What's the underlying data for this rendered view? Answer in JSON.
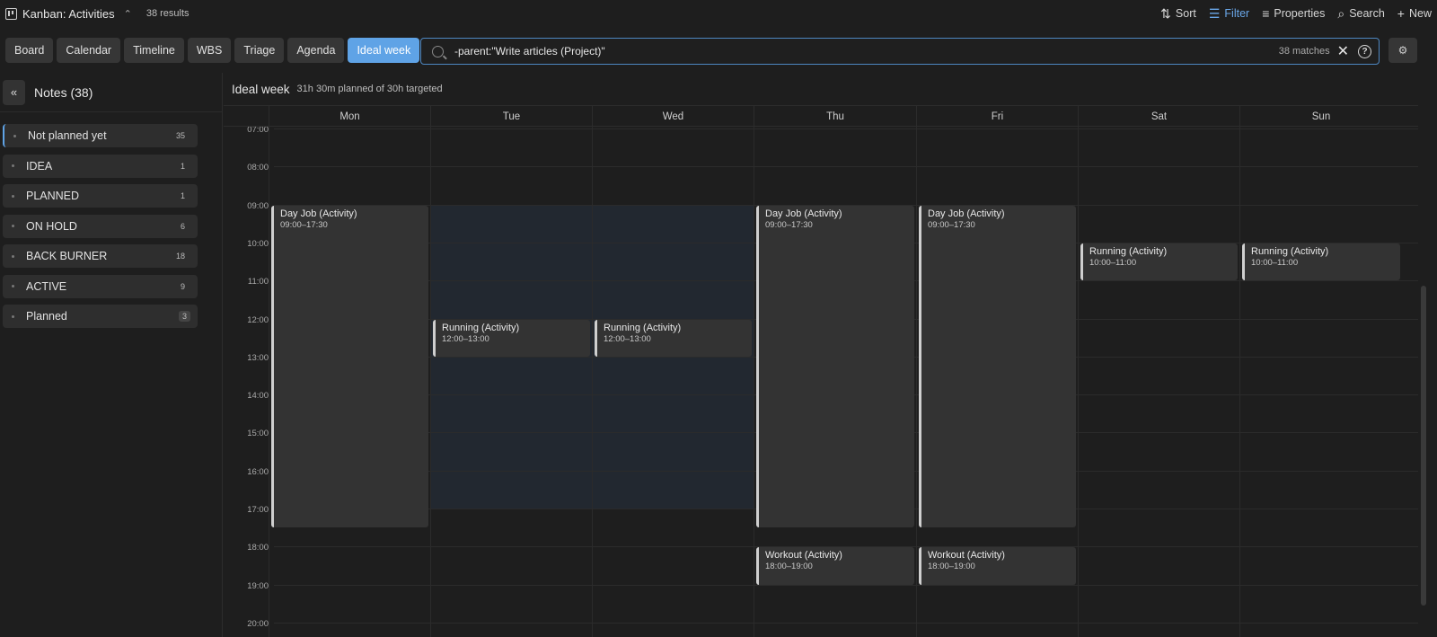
{
  "topbar": {
    "title": "Kanban: Activities",
    "results": "38 results",
    "actions": [
      {
        "name": "sort",
        "label": "Sort",
        "icon": "sort-icon"
      },
      {
        "name": "filter",
        "label": "Filter",
        "icon": "filter-icon",
        "active": true
      },
      {
        "name": "properties",
        "label": "Properties",
        "icon": "list-icon"
      },
      {
        "name": "search",
        "label": "Search",
        "icon": "search-icon"
      },
      {
        "name": "new",
        "label": "New",
        "icon": "plus-icon"
      }
    ]
  },
  "views": [
    "Board",
    "Calendar",
    "Timeline",
    "WBS",
    "Triage",
    "Agenda",
    "Ideal week"
  ],
  "active_view": "Ideal week",
  "search": {
    "query": "-parent:\"Write articles (Project)\"",
    "matches": "38 matches"
  },
  "sidebar": {
    "title": "Notes (38)",
    "groups": [
      {
        "label": "Not planned yet",
        "count": "35"
      },
      {
        "label": "IDEA",
        "count": "1"
      },
      {
        "label": "PLANNED",
        "count": "1"
      },
      {
        "label": "ON HOLD",
        "count": "6"
      },
      {
        "label": "BACK BURNER",
        "count": "18"
      },
      {
        "label": "ACTIVE",
        "count": "9"
      },
      {
        "label": "Planned",
        "count": "3"
      }
    ]
  },
  "calendar": {
    "title": "Ideal week",
    "summary": "31h 30m planned of 30h targeted",
    "days": [
      "Mon",
      "Tue",
      "Wed",
      "Thu",
      "Fri",
      "Sat",
      "Sun"
    ],
    "hours": [
      "07:00",
      "08:00",
      "09:00",
      "10:00",
      "11:00",
      "12:00",
      "13:00",
      "14:00",
      "15:00",
      "16:00",
      "17:00",
      "18:00",
      "19:00",
      "20:00"
    ],
    "events": [
      {
        "day": 0,
        "name": "Day Job (Activity)",
        "time": "09:00–17:30",
        "start": 9,
        "end": 17.5
      },
      {
        "day": 1,
        "name": "Running (Activity)",
        "time": "12:00–13:00",
        "start": 12,
        "end": 13
      },
      {
        "day": 2,
        "name": "Running (Activity)",
        "time": "12:00–13:00",
        "start": 12,
        "end": 13
      },
      {
        "day": 3,
        "name": "Day Job (Activity)",
        "time": "09:00–17:30",
        "start": 9,
        "end": 17.5
      },
      {
        "day": 3,
        "name": "Workout (Activity)",
        "time": "18:00–19:00",
        "start": 18,
        "end": 19
      },
      {
        "day": 4,
        "name": "Day Job (Activity)",
        "time": "09:00–17:30",
        "start": 9,
        "end": 17.5
      },
      {
        "day": 4,
        "name": "Workout (Activity)",
        "time": "18:00–19:00",
        "start": 18,
        "end": 19
      },
      {
        "day": 5,
        "name": "Running (Activity)",
        "time": "10:00–11:00",
        "start": 10,
        "end": 11
      },
      {
        "day": 6,
        "name": "Running (Activity)",
        "time": "10:00–11:00",
        "start": 10,
        "end": 11
      }
    ]
  }
}
